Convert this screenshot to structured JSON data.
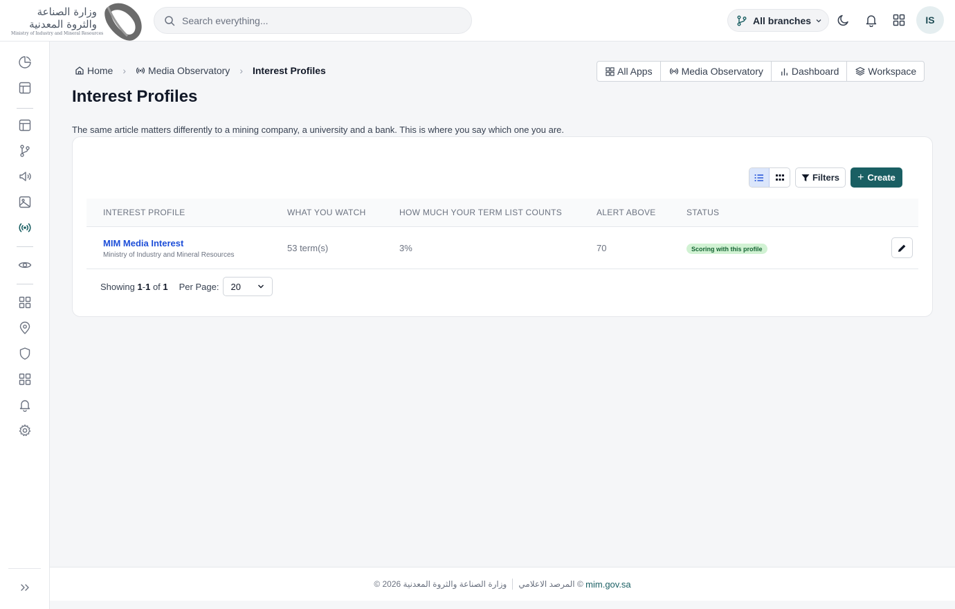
{
  "header": {
    "logo_ar": "وزارة الصناعة والثروة المعدنية",
    "logo_en": "Ministry of Industry and Mineral Resources",
    "search_placeholder": "Search everything...",
    "branch_label": "All branches",
    "avatar_initials": "IS"
  },
  "breadcrumb": {
    "home": "Home",
    "section": "Media Observatory",
    "current": "Interest Profiles"
  },
  "app_nav": {
    "all_apps": "All Apps",
    "media_observatory": "Media Observatory",
    "dashboard": "Dashboard",
    "workspace": "Workspace"
  },
  "page": {
    "title": "Interest Profiles",
    "description": "The same article matters differently to a mining company, a university and a bank. This is where you say which one you are."
  },
  "toolbar": {
    "filters_label": "Filters",
    "create_label": "Create",
    "create_plus": "+"
  },
  "table": {
    "columns": [
      "INTEREST PROFILE",
      "WHAT YOU WATCH",
      "HOW MUCH YOUR TERM LIST COUNTS",
      "ALERT ABOVE",
      "STATUS"
    ],
    "rows": [
      {
        "name": "MIM Media Interest",
        "org": "Ministry of Industry and Mineral Resources",
        "watch": "53 term(s)",
        "weight": "3%",
        "alert_above": "70",
        "status": "Scoring with this profile"
      }
    ]
  },
  "pager": {
    "showing_prefix": "Showing",
    "range_start": "1",
    "range_sep": "-",
    "range_end": "1",
    "of_text": "of",
    "total": "1",
    "per_page_label": "Per Page:",
    "per_page_value": "20"
  },
  "footer": {
    "copyright": "© 2026 وزارة الصناعة والثروة المعدنية",
    "observatory": "المرصد الاعلامي ©",
    "link": "mim.gov.sa"
  },
  "colors": {
    "primary": "#1a5f63",
    "link": "#1d4ed8",
    "status_bg": "#d1f2d3",
    "status_fg": "#166534"
  }
}
